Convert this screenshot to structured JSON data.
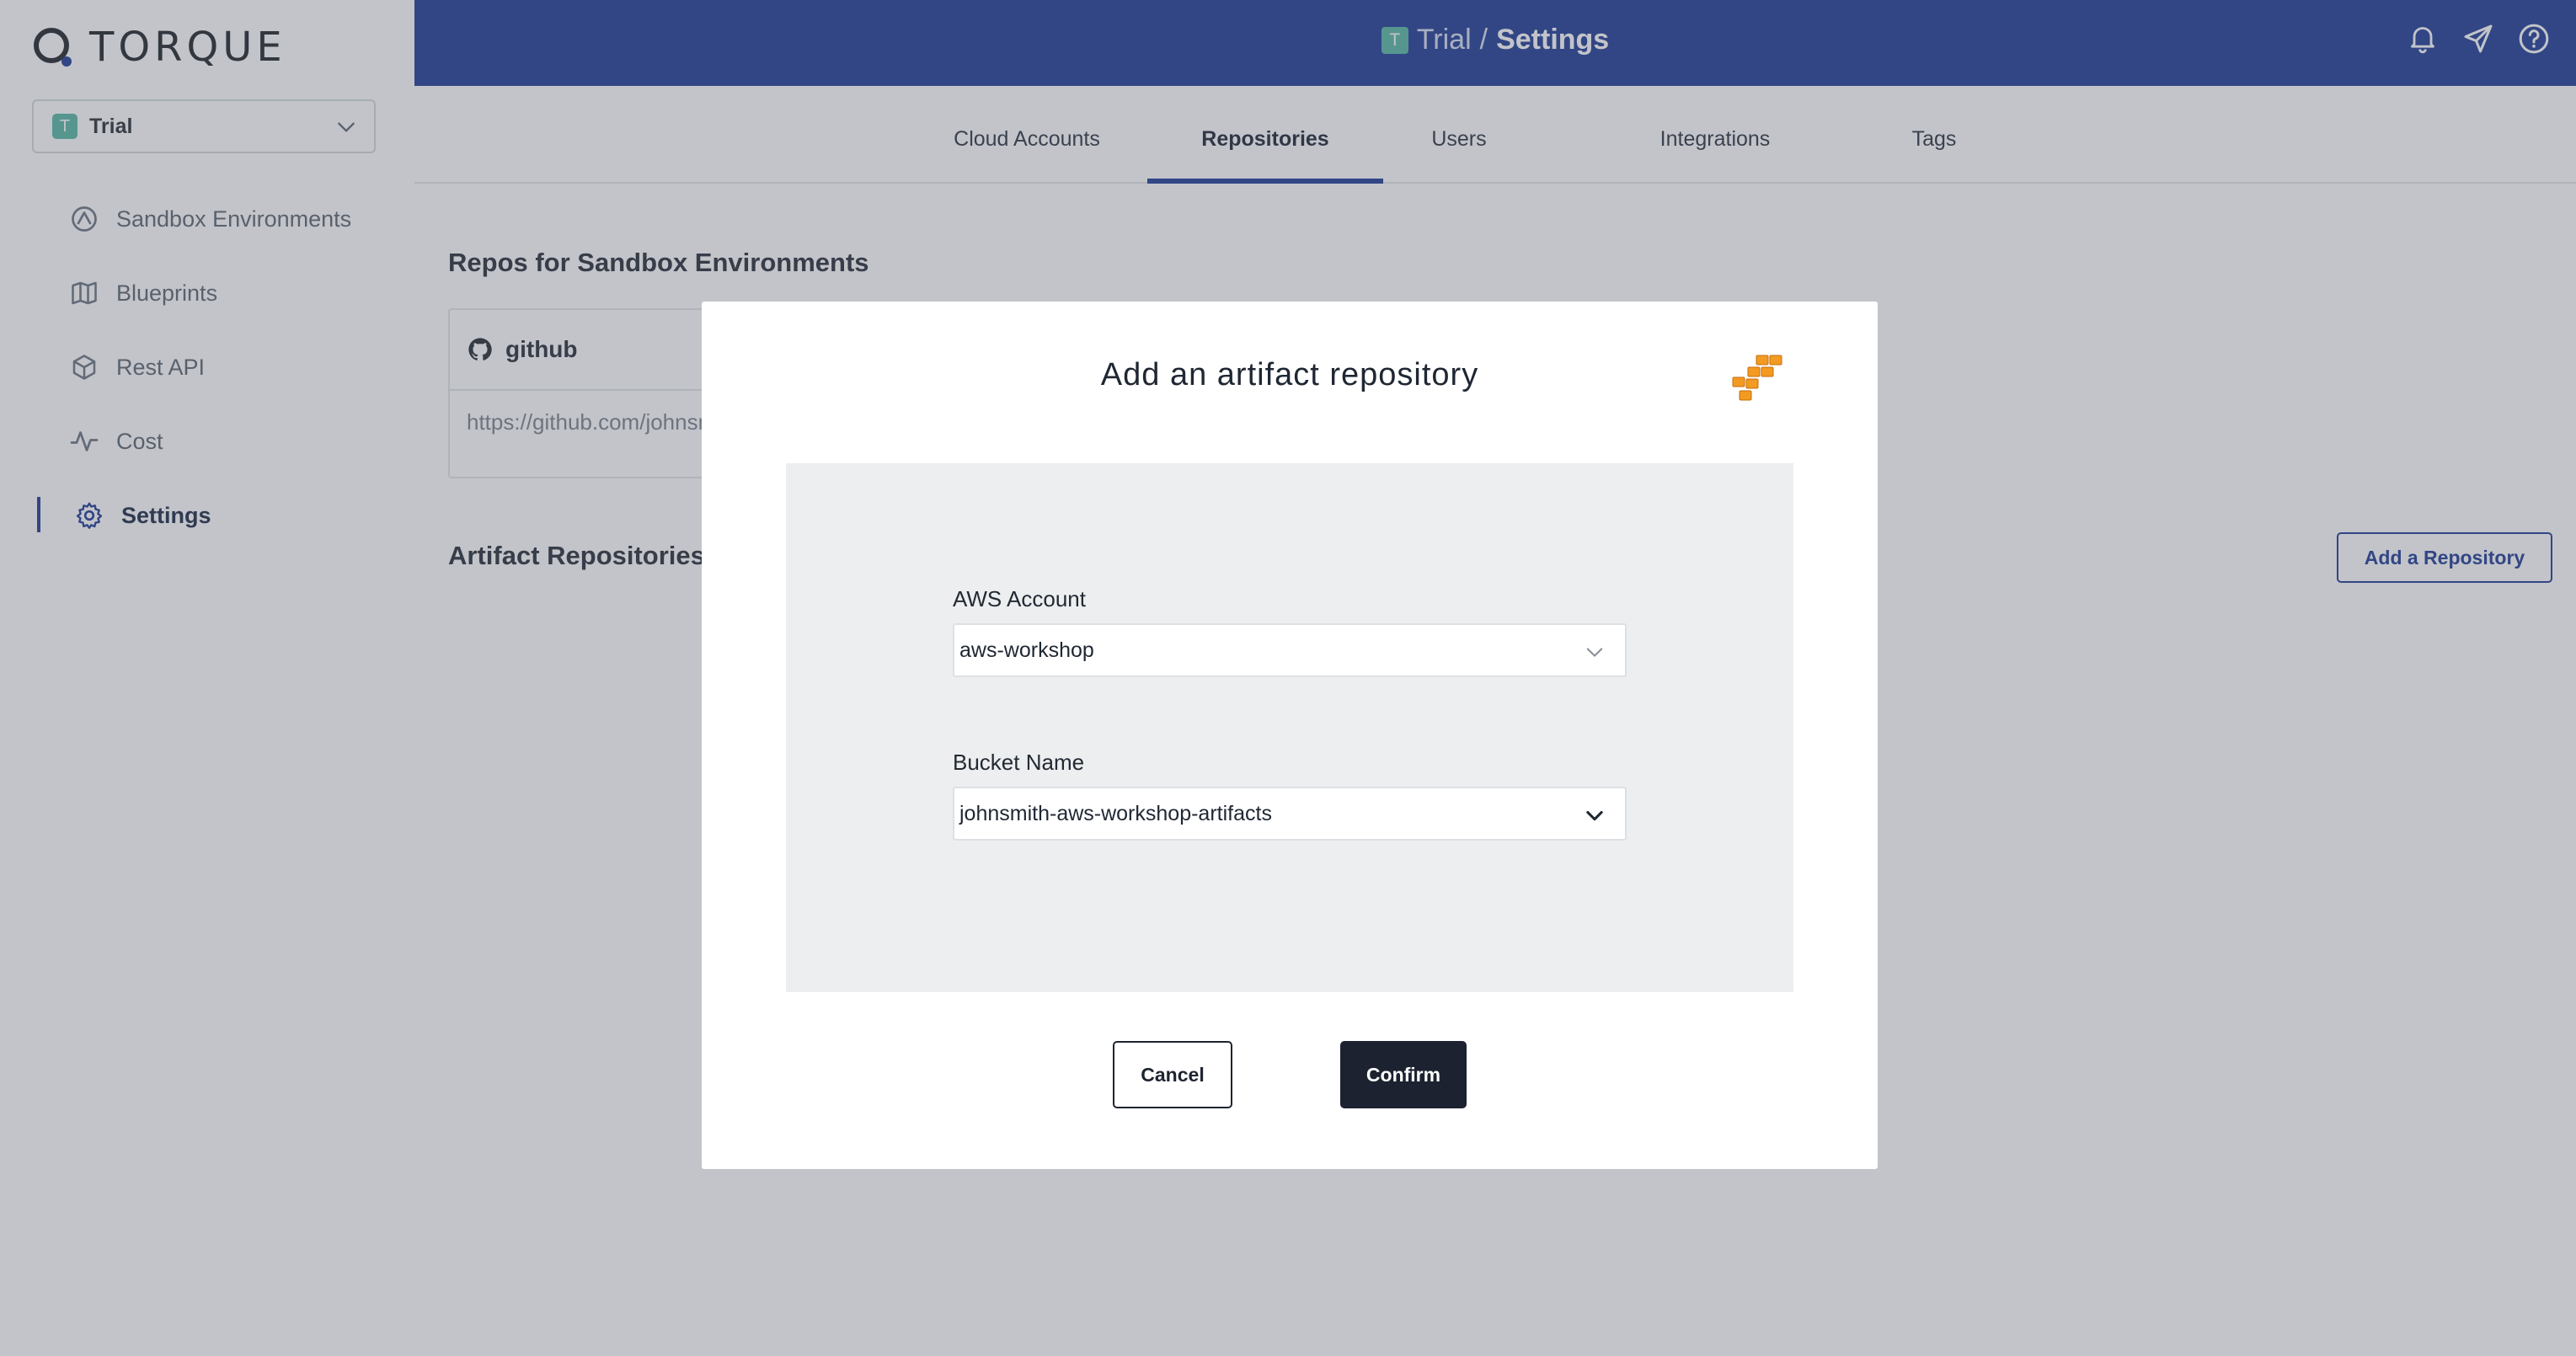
{
  "app": {
    "logo_text": "TORQUE"
  },
  "space_selector": {
    "badge": "T",
    "name": "Trial",
    "icon": "chevron-down-icon"
  },
  "sidebar": {
    "items": [
      {
        "label": "Sandbox Environments",
        "icon": "sandbox-icon",
        "active": false
      },
      {
        "label": "Blueprints",
        "icon": "map-icon",
        "active": false
      },
      {
        "label": "Rest API",
        "icon": "cube-icon",
        "active": false
      },
      {
        "label": "Cost",
        "icon": "activity-icon",
        "active": false
      },
      {
        "label": "Settings",
        "icon": "gear-icon",
        "active": true
      }
    ]
  },
  "header": {
    "badge": "T",
    "space": "Trial",
    "separator": "/",
    "page": "Settings",
    "icons": [
      "bell-icon",
      "send-icon",
      "help-icon"
    ]
  },
  "tabs": [
    {
      "label": "Cloud Accounts",
      "active": false
    },
    {
      "label": "Repositories",
      "active": true
    },
    {
      "label": "Users",
      "active": false
    },
    {
      "label": "Integrations",
      "active": false
    },
    {
      "label": "Tags",
      "active": false
    }
  ],
  "main": {
    "repos_title": "Repos for Sandbox Environments",
    "repo_card": {
      "provider": "github",
      "url": "https://github.com/johnsmith"
    },
    "artifact_title": "Artifact Repositories",
    "add_repository_label": "Add a Repository"
  },
  "modal": {
    "title": "Add an artifact repository",
    "icon": "aws-s3-icon",
    "aws_account": {
      "label": "AWS Account",
      "value": "aws-workshop"
    },
    "bucket_name": {
      "label": "Bucket Name",
      "value": "johnsmith-aws-workshop-artifacts"
    },
    "cancel_label": "Cancel",
    "confirm_label": "Confirm"
  },
  "colors": {
    "brand_blue": "#1e3b95",
    "space_badge": "#57b8a5",
    "confirm_button": "#1c2230",
    "aws_orange": "#f39a22"
  }
}
